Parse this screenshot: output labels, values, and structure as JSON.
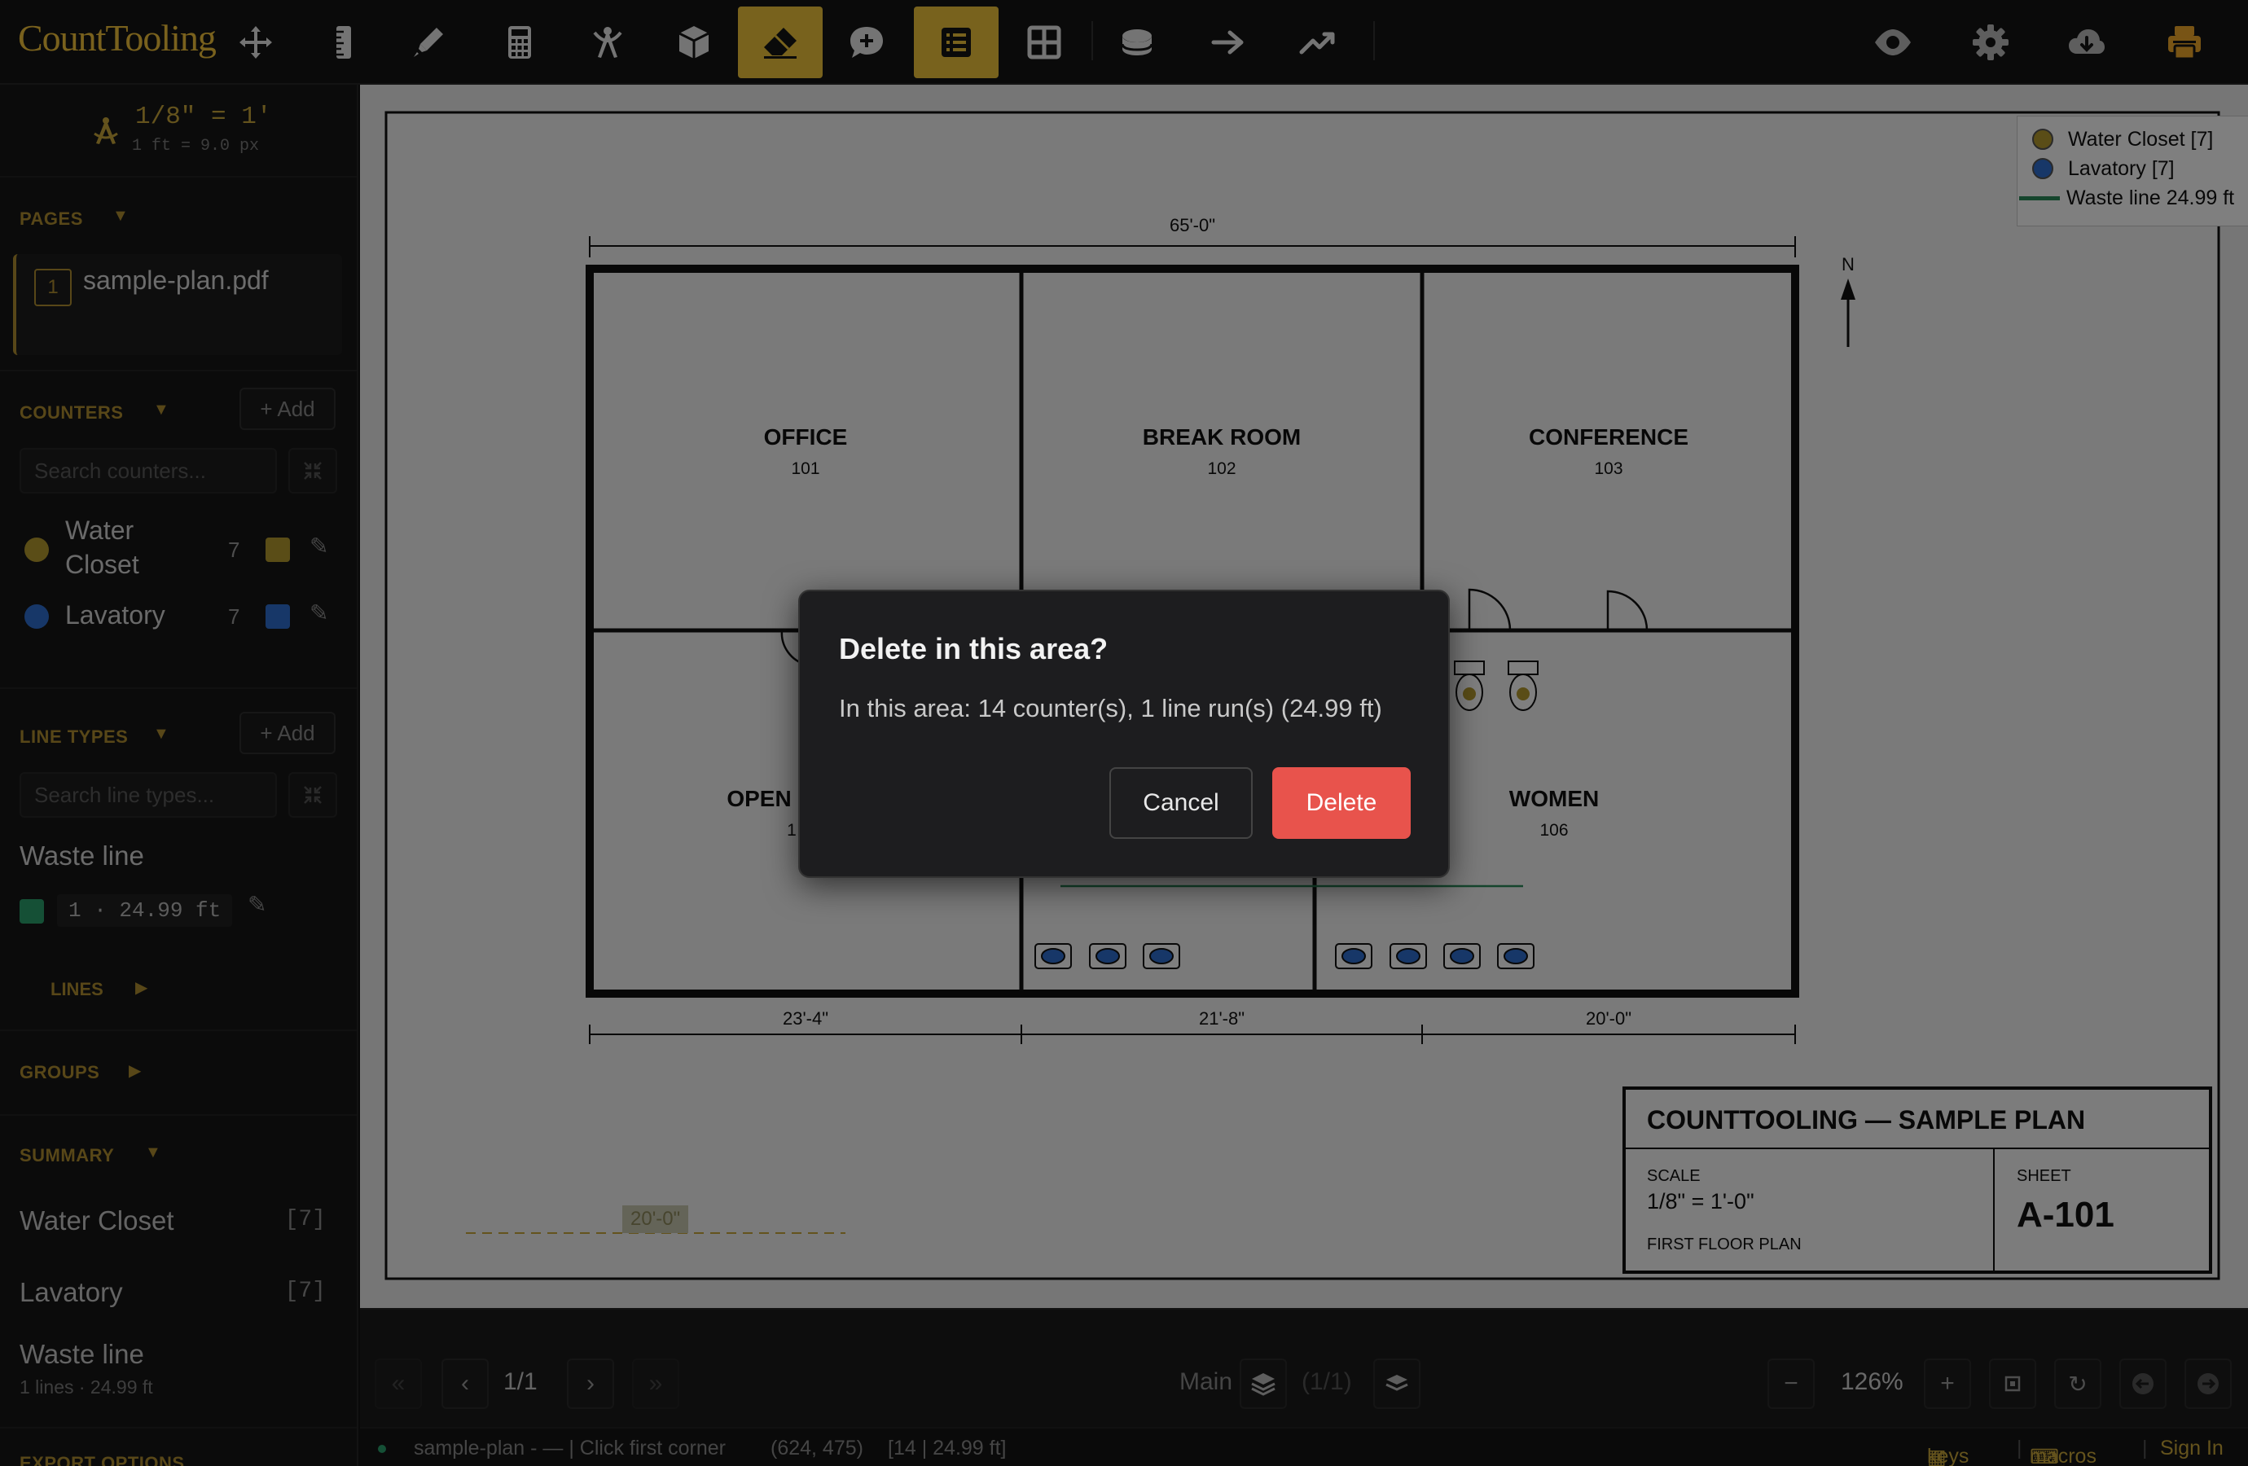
{
  "app": {
    "brand": "CountTooling"
  },
  "toolbar": {
    "tools": [
      {
        "name": "move-icon",
        "active": false
      },
      {
        "name": "ruler-icon",
        "active": false
      },
      {
        "name": "marker-icon",
        "active": false
      },
      {
        "name": "calculator-icon",
        "active": false
      },
      {
        "name": "compass-icon",
        "active": false
      },
      {
        "name": "cube-icon",
        "active": false
      },
      {
        "name": "eraser-icon",
        "active": true
      },
      {
        "name": "comment-icon",
        "active": false
      },
      {
        "name": "list-icon",
        "active": true
      },
      {
        "name": "grid-icon",
        "active": false
      },
      {
        "name": "database-icon",
        "active": false
      },
      {
        "name": "arrow-right-icon",
        "active": false
      },
      {
        "name": "trend-icon",
        "active": false
      }
    ],
    "right_tools": [
      "eye-icon",
      "gear-icon",
      "cloud-download-icon",
      "print-icon"
    ],
    "accent": "#f0c53a"
  },
  "sidebar": {
    "scale": {
      "label": "1/8\" = 1'",
      "ratio": "1 ft = 9.0 px"
    },
    "pages": {
      "heading": "PAGES",
      "items": [
        {
          "num": "1",
          "name": "sample-plan.pdf"
        }
      ]
    },
    "counters": {
      "heading": "COUNTERS",
      "add": "+ Add",
      "search_placeholder": "Search counters...",
      "items": [
        {
          "name_line1": "Water",
          "name_line2": "Closet",
          "count": "7",
          "color": "#b59a2e"
        },
        {
          "name": "Lavatory",
          "count": "7",
          "color": "#2f6fd0"
        }
      ]
    },
    "line_types": {
      "heading": "LINE TYPES",
      "add": "+ Add",
      "search_placeholder": "Search line types...",
      "item": {
        "name": "Waste line",
        "stats": "1 · 24.99 ft",
        "color": "#2aa06c"
      },
      "lines_heading": "LINES"
    },
    "groups": {
      "heading": "GROUPS"
    },
    "summary": {
      "heading": "SUMMARY",
      "rows": [
        {
          "name": "Water Closet",
          "count": "[7]"
        },
        {
          "name": "Lavatory",
          "count": "[7]"
        }
      ],
      "waste": {
        "name": "Waste line",
        "sub": "1 lines · 24.99 ft"
      }
    },
    "export": {
      "heading": "EXPORT OPTIONS"
    }
  },
  "plan": {
    "overall_dim": "65'-0\"",
    "north": "N",
    "rooms": [
      {
        "name": "OFFICE",
        "num": "101"
      },
      {
        "name": "BREAK ROOM",
        "num": "102"
      },
      {
        "name": "CONFERENCE",
        "num": "103"
      },
      {
        "name": "OPEN",
        "num": "1"
      },
      {
        "name": "WOMEN",
        "num": "106"
      }
    ],
    "bottom_dims": [
      "23'-4\"",
      "21'-8\"",
      "20'-0\""
    ],
    "ghost_dim": "20'-0\"",
    "titleblock": {
      "title": "COUNTTOOLING — SAMPLE PLAN",
      "scale_label": "SCALE",
      "scale_value": "1/8\" = 1'-0\"",
      "subtitle": "FIRST FLOOR PLAN",
      "sheet_label": "SHEET",
      "sheet_value": "A-101"
    }
  },
  "legend": {
    "items": [
      {
        "label": "Water Closet [7]",
        "color": "#b59a2e"
      },
      {
        "label": "Lavatory [7]",
        "color": "#2f6fd0"
      },
      {
        "label": "Waste line 24.99 ft",
        "color": "#2a8a5a"
      }
    ]
  },
  "pager": {
    "page": "1/1",
    "layer": "Main",
    "layer_count": "(1/1)",
    "zoom": "126%"
  },
  "status": {
    "file": "sample-plan - — | Click first corner",
    "coords": "(624, 475)",
    "totals": "[14 | 24.99 ft]",
    "keys": "keys",
    "macros": "macros",
    "signin": "Sign In"
  },
  "modal": {
    "title": "Delete in this area?",
    "body": "In this area: 14 counter(s), 1 line run(s) (24.99 ft)",
    "cancel": "Cancel",
    "delete": "Delete"
  }
}
